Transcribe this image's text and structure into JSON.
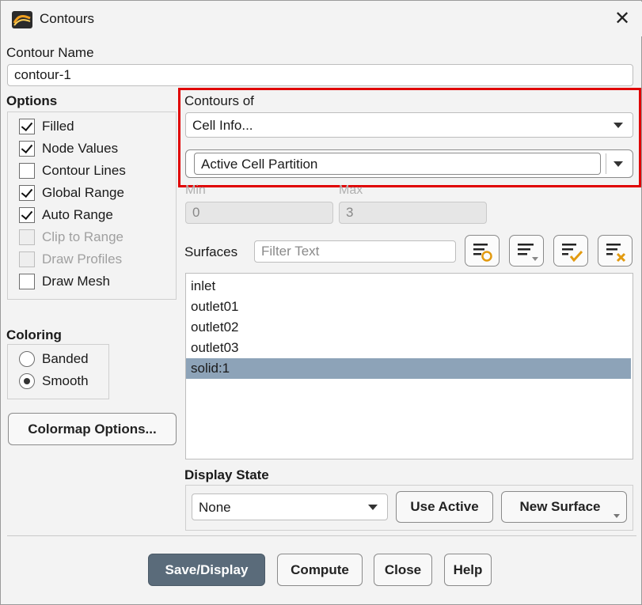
{
  "window": {
    "title": "Contours"
  },
  "contour_name": {
    "label": "Contour Name",
    "value": "contour-1"
  },
  "options": {
    "label": "Options",
    "items": [
      {
        "label": "Filled",
        "checked": true,
        "disabled": false
      },
      {
        "label": "Node Values",
        "checked": true,
        "disabled": false
      },
      {
        "label": "Contour Lines",
        "checked": false,
        "disabled": false
      },
      {
        "label": "Global Range",
        "checked": true,
        "disabled": false
      },
      {
        "label": "Auto Range",
        "checked": true,
        "disabled": false
      },
      {
        "label": "Clip to Range",
        "checked": false,
        "disabled": true
      },
      {
        "label": "Draw Profiles",
        "checked": false,
        "disabled": true
      },
      {
        "label": "Draw Mesh",
        "checked": false,
        "disabled": false
      }
    ]
  },
  "coloring": {
    "label": "Coloring",
    "items": [
      {
        "label": "Banded",
        "selected": false
      },
      {
        "label": "Smooth",
        "selected": true
      }
    ]
  },
  "colormap_button": "Colormap Options...",
  "contours_of": {
    "label": "Contours of",
    "category": "Cell Info...",
    "field": "Active Cell Partition"
  },
  "range": {
    "min_label": "Min",
    "min_value": "0",
    "max_label": "Max",
    "max_value": "3"
  },
  "surfaces": {
    "label": "Surfaces",
    "filter_placeholder": "Filter Text",
    "items": [
      "inlet",
      "outlet01",
      "outlet02",
      "outlet03",
      "solid:1"
    ],
    "selected_index": 4
  },
  "display_state": {
    "label": "Display State",
    "value": "None",
    "use_active": "Use Active",
    "new_surface": "New Surface"
  },
  "footer": {
    "save_display": "Save/Display",
    "compute": "Compute",
    "close": "Close",
    "help": "Help"
  },
  "colors": {
    "highlight": "#e00000",
    "selection": "#8da3b8",
    "primary_button": "#5a6b7a"
  }
}
